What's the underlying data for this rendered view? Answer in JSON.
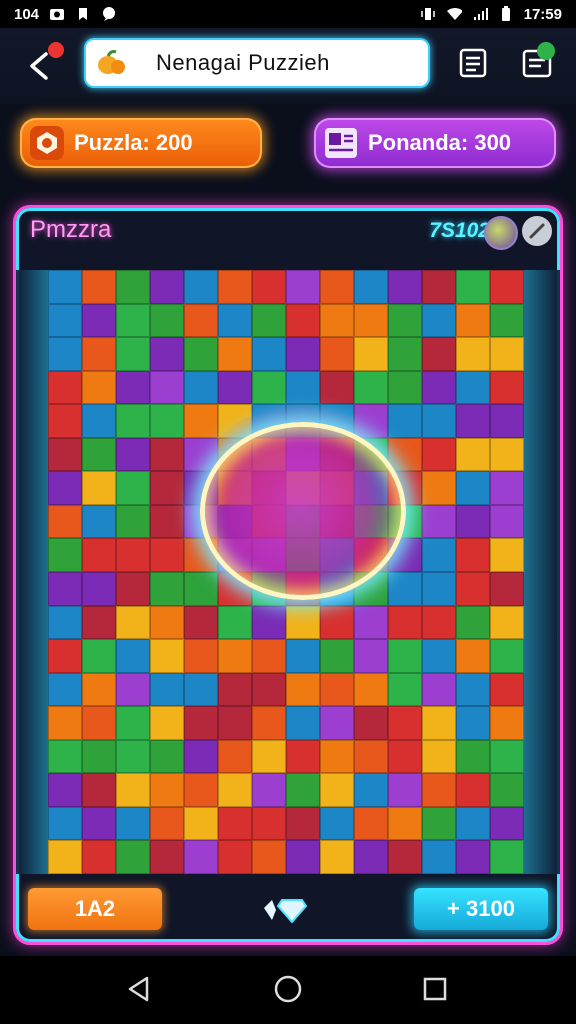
{
  "status_bar": {
    "time_left": "104",
    "clock": "17:59"
  },
  "header": {
    "search_value": "Nenagai Puzzieh"
  },
  "stats": {
    "left_pill": "Puzzla: 200",
    "right_pill": "Ponanda: 300"
  },
  "board": {
    "title": "Pmzzra",
    "score": "7S102"
  },
  "footer": {
    "left_button": "1A2",
    "right_button": "+ 3100"
  },
  "colors": {
    "accent_cyan": "#3fe3ff",
    "accent_pink": "#ff4fd8",
    "orange": "#f07310",
    "purple": "#8d2bd0"
  },
  "icons": {
    "back": "back-chevron-icon",
    "menu": "notes-icon",
    "inbox": "inbox-icon",
    "edit": "edit-pencil-icon",
    "gem": "gem-icon"
  }
}
